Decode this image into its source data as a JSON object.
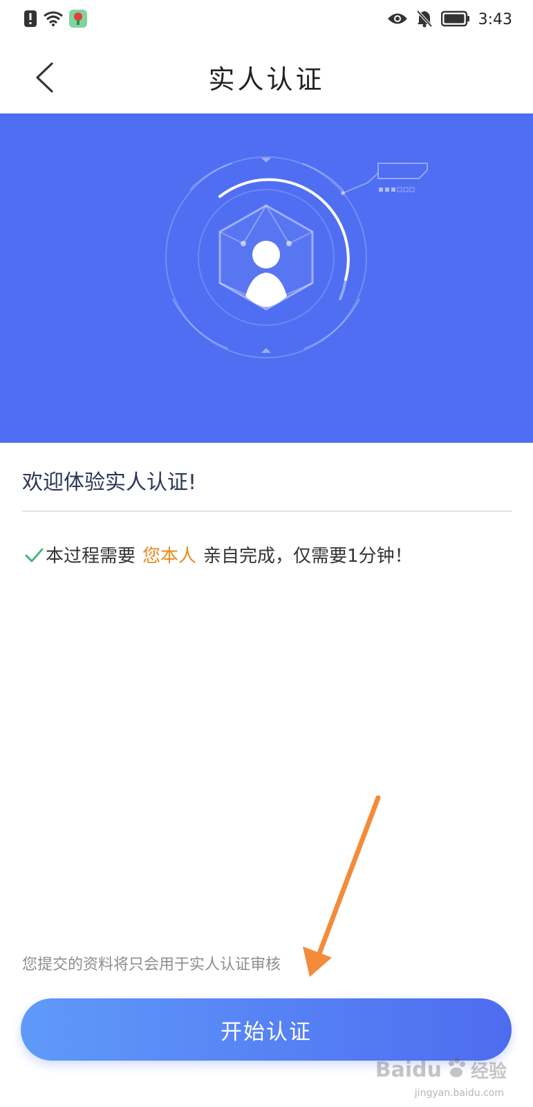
{
  "status_bar": {
    "time": "3:43"
  },
  "nav": {
    "title": "实人认证"
  },
  "content": {
    "welcome": "欢迎体验实人认证!",
    "notice_prefix": "本过程需要",
    "notice_highlight": "您本人",
    "notice_suffix": "亲自完成，仅需要1分钟！",
    "privacy": "您提交的资料将只会用于实人认证审核"
  },
  "actions": {
    "start_label": "开始认证"
  },
  "watermark": {
    "brand": "Baidu",
    "sub": "经验",
    "url": "jingyan.baidu.com"
  },
  "colors": {
    "hero_bg": "#4f6ef2",
    "highlight": "#e98a1e",
    "check": "#3cb371",
    "button_start": "#5f9af8",
    "button_end": "#4e6cf0",
    "arrow": "#f38b3a"
  }
}
